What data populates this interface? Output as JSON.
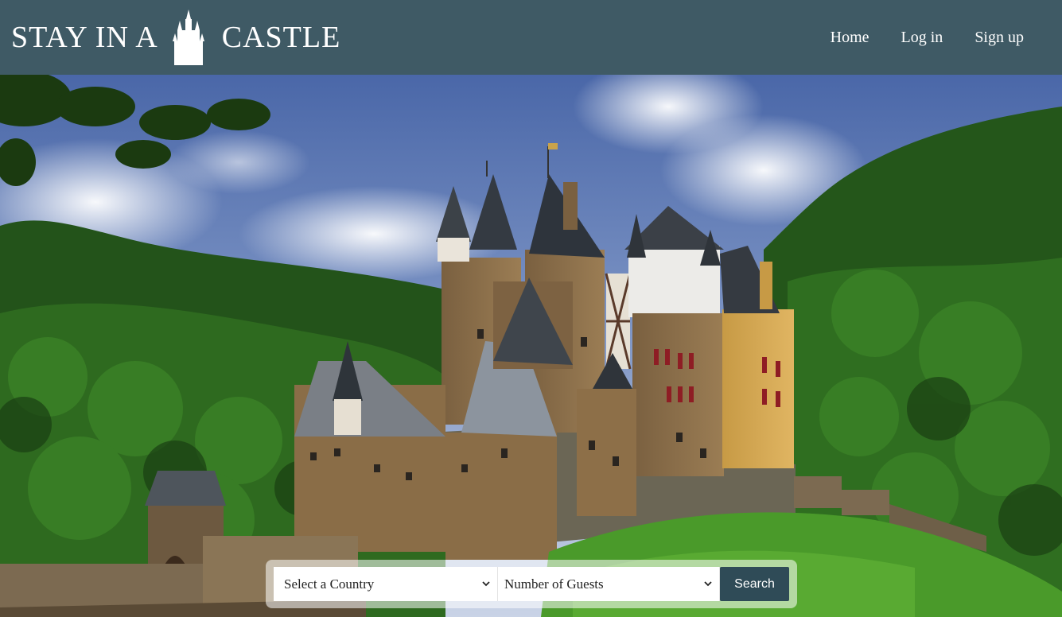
{
  "header": {
    "logo_left": "STAY IN A",
    "logo_right": "CASTLE",
    "logo_icon": "castle-icon",
    "nav": {
      "home": "Home",
      "login": "Log in",
      "signup": "Sign up"
    }
  },
  "hero": {
    "image": "castle-landscape-photo"
  },
  "search": {
    "country_select": "Select a Country",
    "guests_select": "Number of Guests",
    "button": "Search",
    "dropdown_icon": "chevron-down-icon"
  },
  "colors": {
    "header_bg": "#3f5a65",
    "button_bg": "#2f4b57",
    "text_light": "#ffffff"
  }
}
